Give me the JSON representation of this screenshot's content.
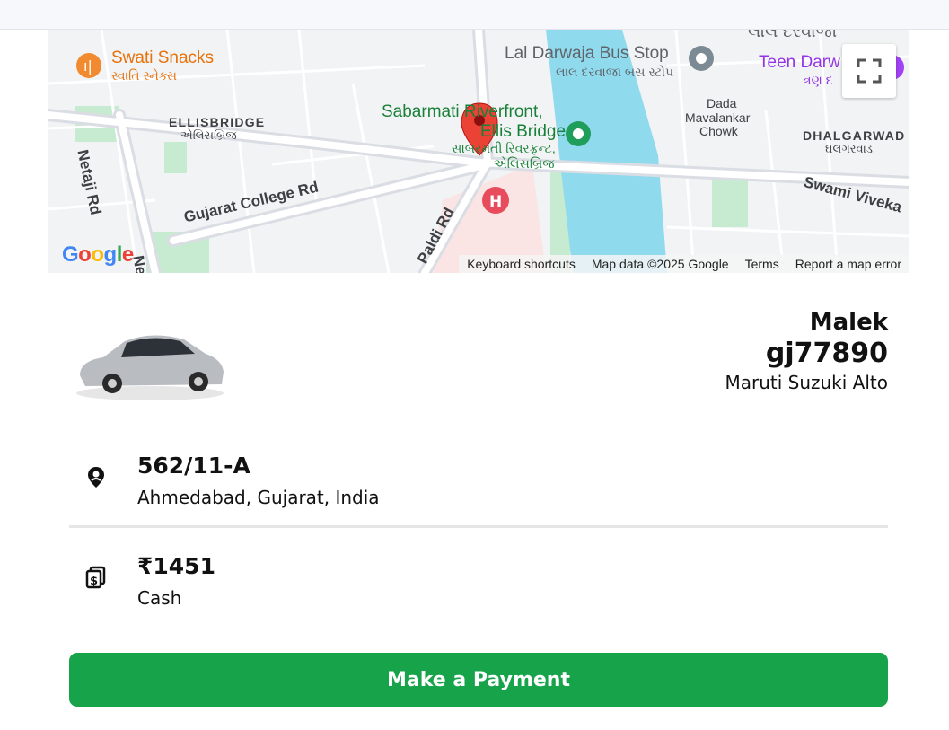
{
  "map": {
    "pois": {
      "swati_snacks": "Swati Snacks",
      "swati_snacks_gu": "સ્વાતિ સ્નેક્સ",
      "bus_stop": "Lal Darwaja Bus Stop",
      "bus_stop_gu": "લાલ દરવાજા બસ સ્ટોપ",
      "teen_darwaja": "Teen Darw",
      "teen_darwaja_gu": "ત્રણ દ",
      "riverfront_line1": "Sabarmati Riverfront,",
      "riverfront_line2": "Ellis Bridge",
      "riverfront_gu1": "સાબરમતી રિવરફ્રન્ટ,",
      "riverfront_gu2": "એલિસબ્રિજ",
      "dada_line1": "Dada",
      "dada_line2": "Mavalankar",
      "dada_line3": "Chowk",
      "top_gu": "લાલ દરવાજા"
    },
    "areas": {
      "ellisbridge": "ELLISBRIDGE",
      "ellisbridge_gu": "એલિસબ્રિજ",
      "dhalgarwad": "DHALGARWAD",
      "dhalgarwad_gu": "ઘલગરવાડ"
    },
    "roads": {
      "netaji": "Netaji Rd",
      "gujarat_college": "Gujarat College Rd",
      "paldi": "Paldi Rd",
      "swami": "Swami Viveka",
      "ne": "Ne"
    },
    "google_logo": "Google",
    "attribution": {
      "shortcuts": "Keyboard shortcuts",
      "map_data": "Map data ©2025 Google",
      "terms": "Terms",
      "report": "Report a map error"
    }
  },
  "driver": {
    "name": "Malek",
    "vehicle_number": "gj77890",
    "vehicle_model": "Maruti Suzuki Alto"
  },
  "trip": {
    "address_line1": "562/11-A",
    "address_line2": "Ahmedabad, Gujarat, India",
    "amount": "₹1451",
    "payment_method": "Cash"
  },
  "actions": {
    "pay_label": "Make a Payment"
  },
  "colors": {
    "primary_button": "#16a34a",
    "map_pin": "#ea4335",
    "river": "#90daee"
  },
  "icons": {
    "location": "location-pin-icon",
    "payment": "money-stack-icon",
    "fullscreen": "fullscreen-icon"
  }
}
